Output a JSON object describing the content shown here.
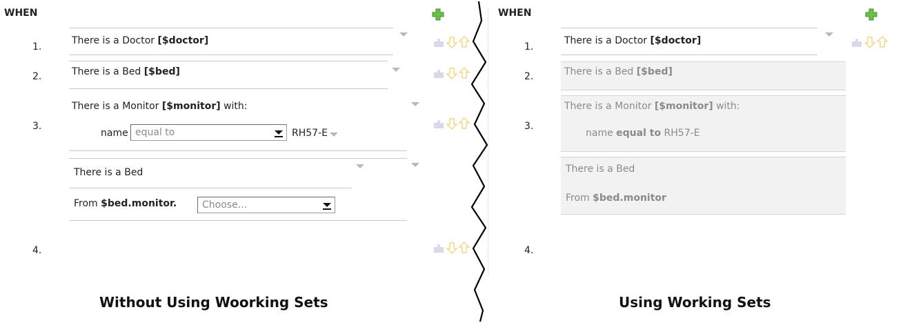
{
  "left": {
    "when_label": "WHEN",
    "row_numbers": [
      "1.",
      "2.",
      "3.",
      "4."
    ],
    "fact1": {
      "prefix": "There is a Doctor ",
      "binding": "[$doctor]"
    },
    "fact2": {
      "prefix": "There is a Bed ",
      "binding": "[$bed]"
    },
    "fact3": {
      "prefix": "There is a Monitor ",
      "binding": "[$monitor]",
      "suffix": " with:",
      "field": "name",
      "operator": "equal to",
      "value": "RH57-E"
    },
    "fact4": {
      "line1": "There is a Bed",
      "from_label": "From ",
      "from_binding": "$bed.monitor.",
      "choose": "Choose..."
    },
    "caption": "Without Using Woorking Sets"
  },
  "right": {
    "when_label": "WHEN",
    "row_numbers": [
      "1.",
      "2.",
      "3.",
      "4."
    ],
    "fact1": {
      "prefix": "There is a Doctor ",
      "binding": "[$doctor]"
    },
    "fact2": {
      "prefix": "There is a Bed ",
      "binding": "[$bed]"
    },
    "fact3": {
      "prefix": "There is a Monitor ",
      "binding": "[$monitor]",
      "suffix": " with:",
      "field": "name ",
      "operator": "equal to",
      "value": "RH57-E"
    },
    "fact4": {
      "line1": "There is a Bed",
      "from_label": "From ",
      "from_binding": "$bed.monitor"
    },
    "caption": "Using Working Sets"
  },
  "icons": {
    "add": "green-plus-icon",
    "insert": "puzzle-insert-icon",
    "down": "arrow-down-icon",
    "up": "arrow-up-icon",
    "dropdown": "chevron-down-icon",
    "select_button": "select-arrow-icon"
  },
  "colors": {
    "add_icon": "#5cb83a",
    "arrow_icon": "#f0d78a",
    "disabled_text": "#8a8a8a",
    "panel_bg": "#f2f2f2"
  }
}
